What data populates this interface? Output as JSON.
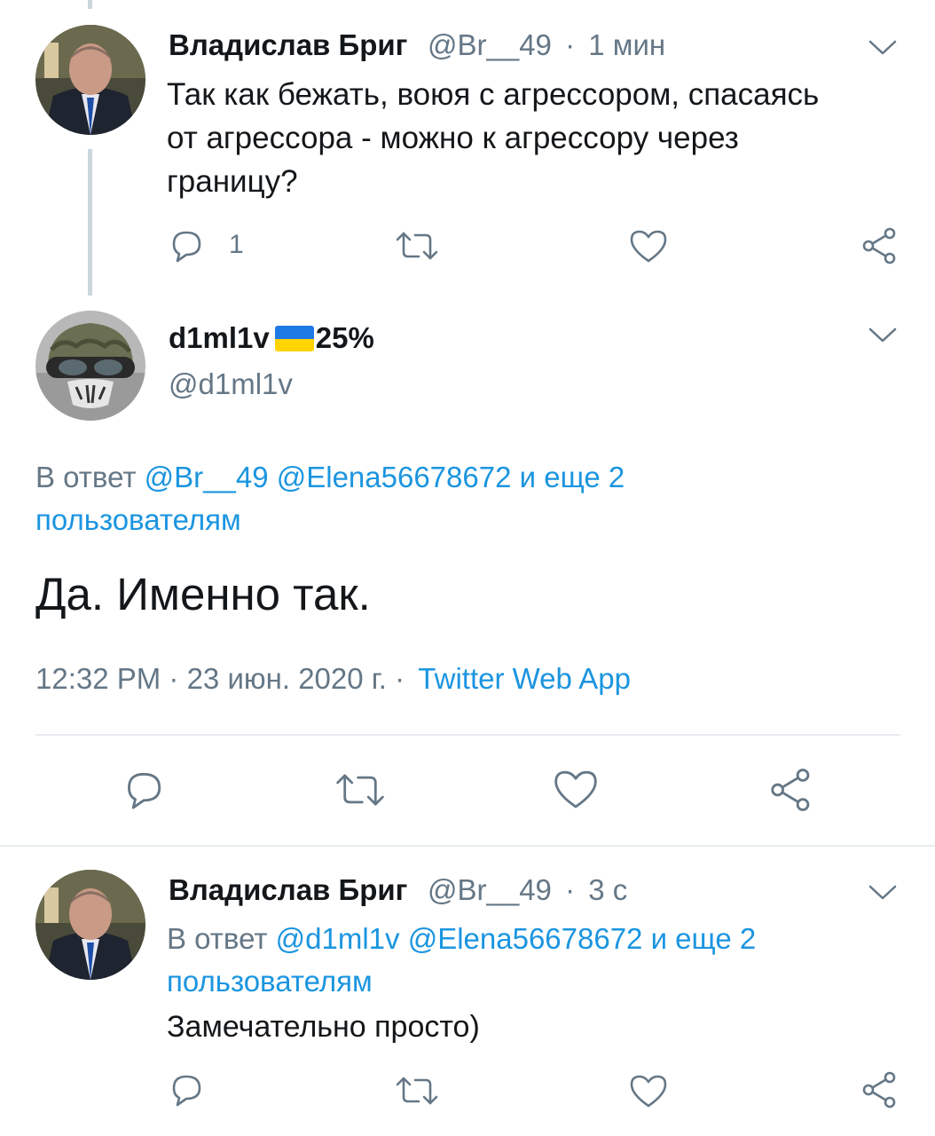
{
  "colors": {
    "accent": "#1b95e0",
    "text": "#14171a",
    "muted": "#657786",
    "flag_blue": "#1f7ae6",
    "flag_yellow": "#ffd400"
  },
  "tweet1": {
    "name": "Владислав Бриг",
    "handle": "@Br__49",
    "sep": "·",
    "time": "1 мин",
    "text_line1": "Так как бежать, воюя с агрессором, спасаясь",
    "text_line2": "от агрессора - можно к агрессору через",
    "text_line3": "границу?",
    "reply_count": "1",
    "icons": [
      "reply-icon",
      "retweet-icon",
      "like-icon",
      "share-icon",
      "chevron-down-icon"
    ]
  },
  "main_tweet": {
    "name": "d1ml1v",
    "flag_icon": "ukraine-flag-icon",
    "name_suffix": "25%",
    "handle": "@d1ml1v",
    "reply_prefix": "В ответ",
    "reply_targets": "@Br__49 @Elena56678672 и еще 2",
    "reply_targets_line2": "пользователям",
    "text": "Да. Именно так.",
    "timestamp": "12:32 PM · 23 июн. 2020 г. ·",
    "source": "Twitter Web App"
  },
  "tweet3": {
    "name": "Владислав Бриг",
    "handle": "@Br__49",
    "sep": "·",
    "time": "3 с",
    "reply_prefix": "В ответ",
    "reply_targets": "@d1ml1v @Elena56678672 и еще 2",
    "reply_targets_line2": "пользователям",
    "text": "Замечательно просто)"
  }
}
